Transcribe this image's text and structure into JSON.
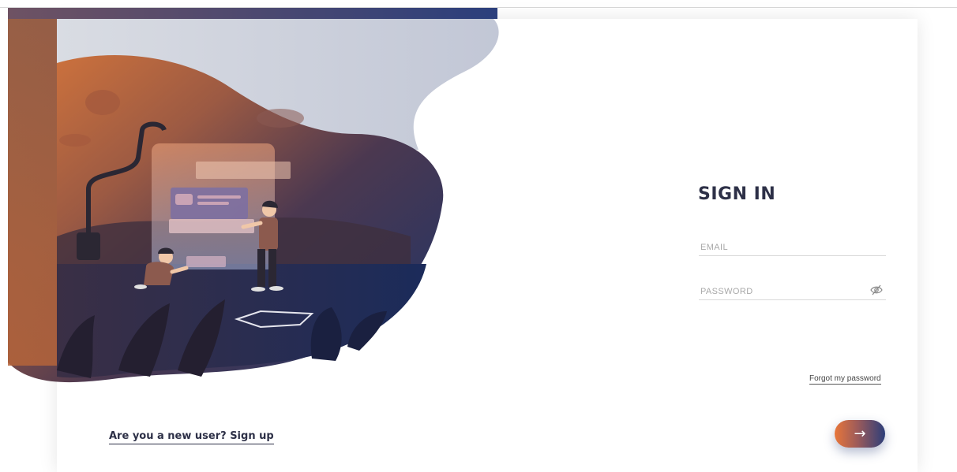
{
  "auth": {
    "title": "SIGN IN",
    "email_placeholder": "EMAIL",
    "password_placeholder": "PASSWORD",
    "forgot_label": "Forgot my password",
    "signup_label": "Are you a new user? Sign up",
    "submit_label": "→"
  },
  "icons": {
    "password_toggle": "eye-off-icon",
    "submit": "arrow-right-icon"
  },
  "colors": {
    "title": "#2d3047",
    "accent_orange": "#e8763a",
    "accent_navy": "#2c3e7a"
  }
}
